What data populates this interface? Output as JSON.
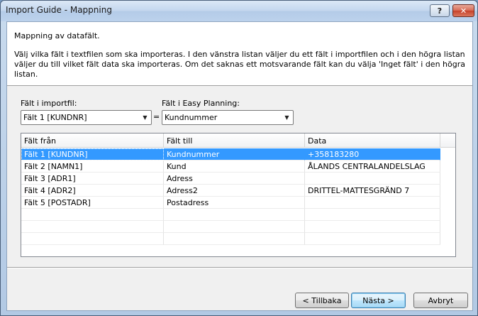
{
  "window": {
    "title": "Import Guide - Mappning",
    "help_label": "?",
    "close_label": "✕"
  },
  "header": {
    "title": "Mappning av datafält.",
    "description": "Välj vilka fält i textfilen som ska importeras. I den vänstra listan väljer du ett fält i importfilen och i den högra listan väljer du till vilket fält data ska importeras. Om det saknas ett motsvarande fält kan du välja 'Inget fält' i den högra listan."
  },
  "mapping": {
    "source_label": "Fält i importfil:",
    "source_value": "Fält 1 [KUNDNR]",
    "equals": "=",
    "target_label": "Fält i Easy Planning:",
    "target_value": "Kundnummer"
  },
  "grid": {
    "columns": [
      "Fält från",
      "Fält till",
      "Data"
    ],
    "rows": [
      {
        "from": "Fält 1 [KUNDNR]",
        "to": "Kundnummer",
        "data": "+358183280"
      },
      {
        "from": "Fält 2 [NAMN1]",
        "to": "Kund",
        "data": "ÅLANDS CENTRALANDELSLAG"
      },
      {
        "from": "Fält 3 [ADR1]",
        "to": "Adress",
        "data": ""
      },
      {
        "from": "Fält 4 [ADR2]",
        "to": "Adress2",
        "data": "DRITTEL-MATTESGRÄND 7"
      },
      {
        "from": "Fält 5 [POSTADR]",
        "to": "Postadress",
        "data": ""
      },
      {
        "from": "",
        "to": "",
        "data": ""
      },
      {
        "from": "",
        "to": "",
        "data": ""
      },
      {
        "from": "",
        "to": "",
        "data": ""
      }
    ]
  },
  "buttons": {
    "back": "< Tillbaka",
    "next": "Nästa >",
    "cancel": "Avbryt"
  }
}
